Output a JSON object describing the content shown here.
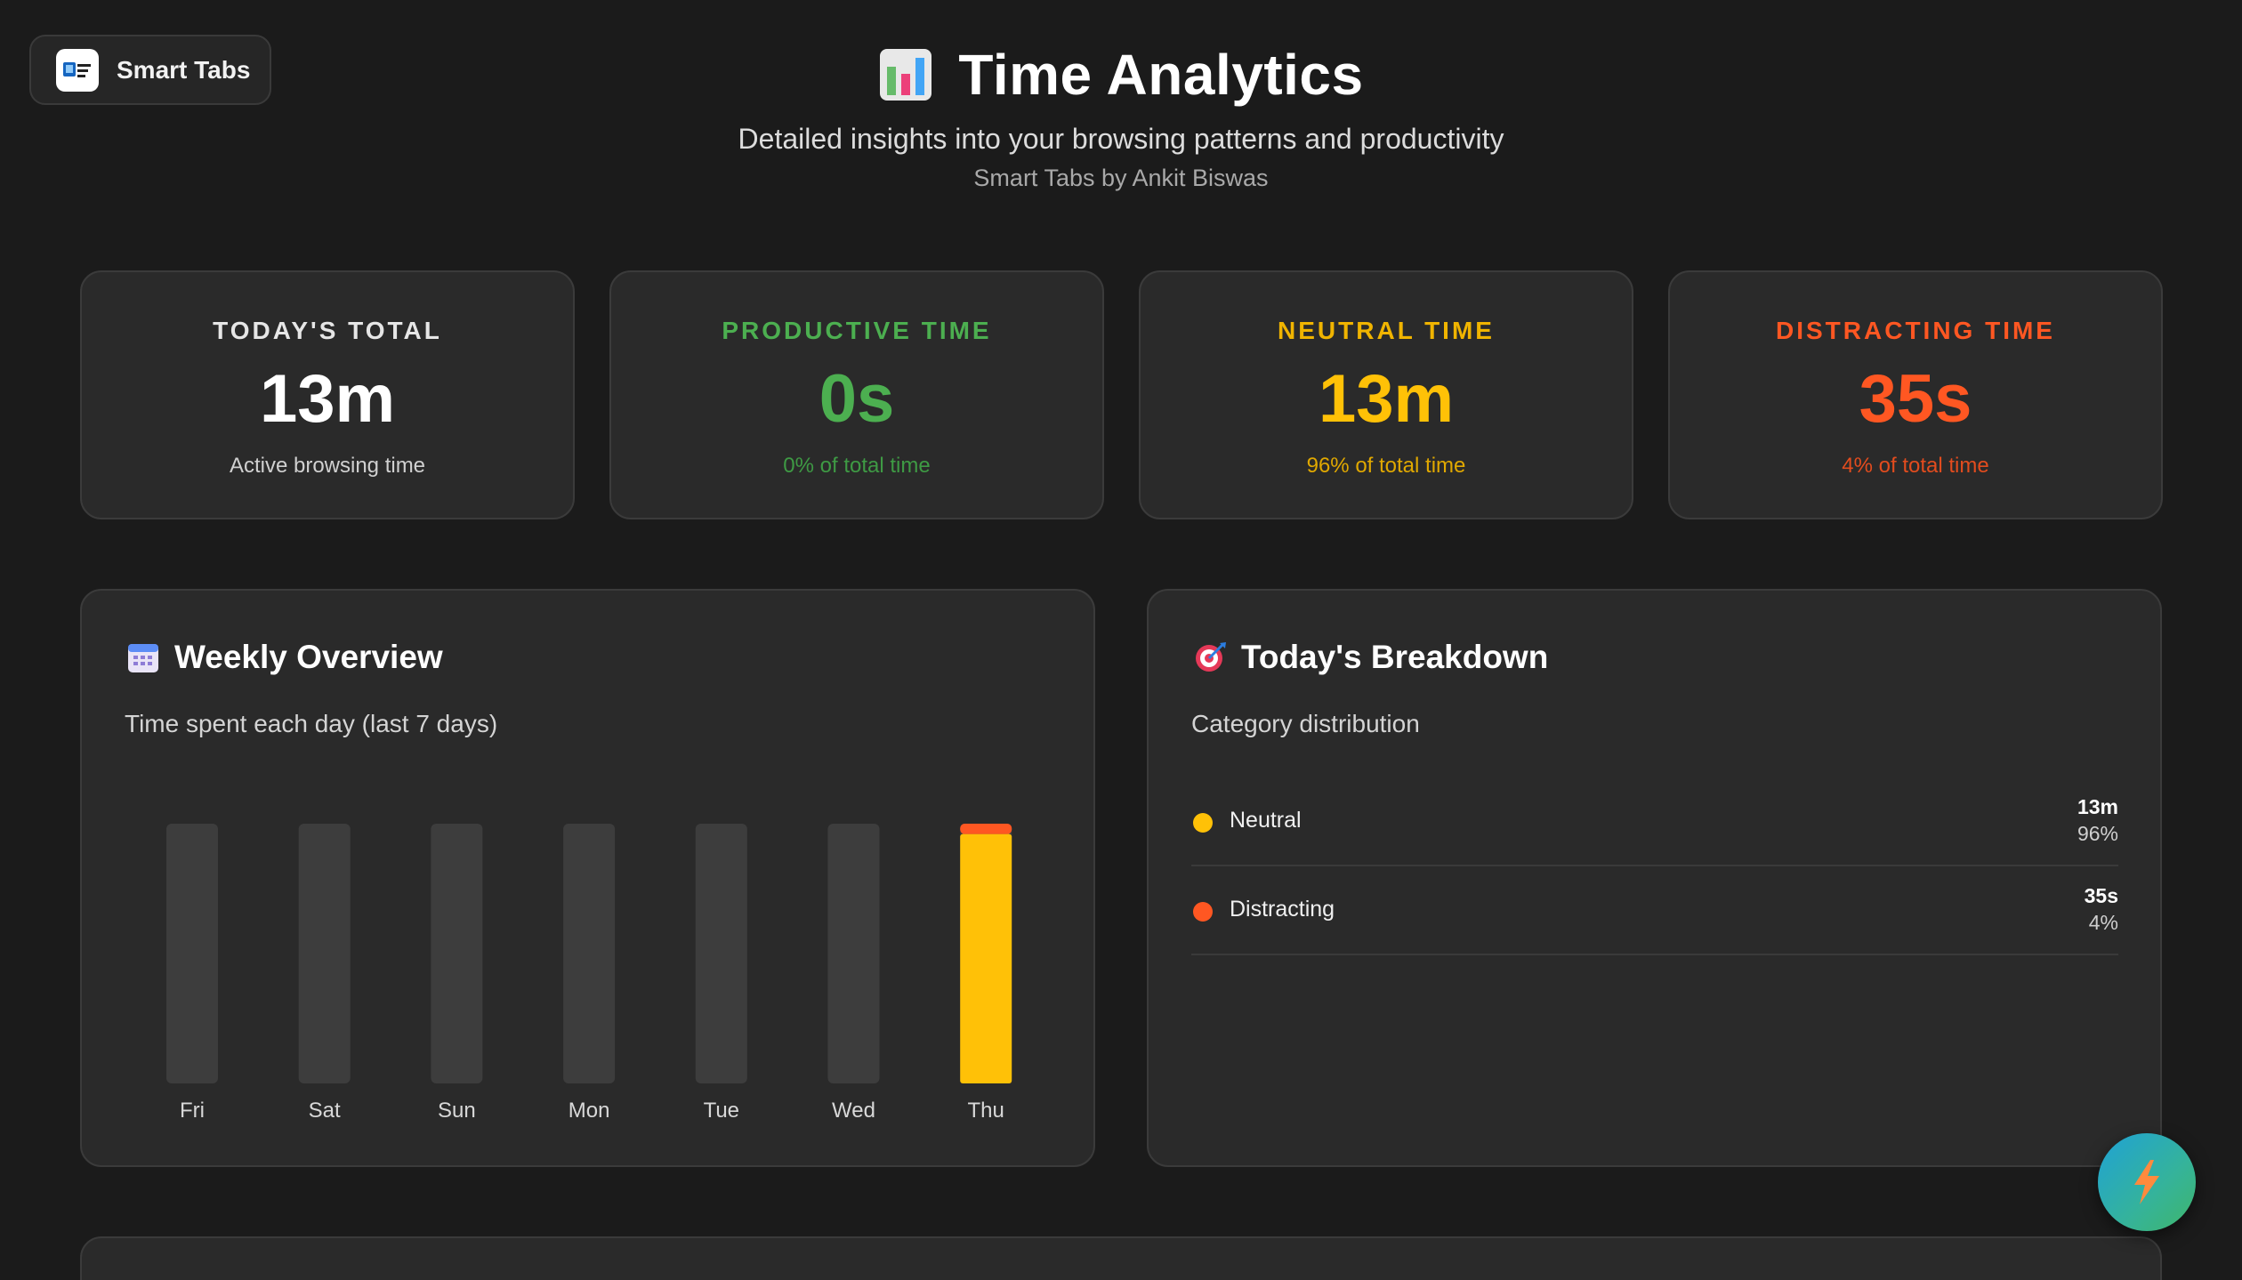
{
  "brand": {
    "name": "Smart Tabs"
  },
  "header": {
    "title": "Time Analytics",
    "subtitle": "Detailed insights into your browsing patterns and productivity",
    "byline": "Smart Tabs by Ankit Biswas"
  },
  "stats": {
    "total": {
      "label": "TODAY'S TOTAL",
      "value": "13m",
      "sub": "Active browsing time",
      "color": "#ffffff"
    },
    "productive": {
      "label": "PRODUCTIVE TIME",
      "value": "0s",
      "sub": "0% of total time",
      "color": "#4caf50"
    },
    "neutral": {
      "label": "NEUTRAL TIME",
      "value": "13m",
      "sub": "96% of total time",
      "color": "#ffc107"
    },
    "distracting": {
      "label": "DISTRACTING TIME",
      "value": "35s",
      "sub": "4% of total time",
      "color": "#ff5722"
    }
  },
  "weekly": {
    "title": "Weekly Overview",
    "description": "Time spent each day (last 7 days)"
  },
  "breakdown": {
    "title": "Today's Breakdown",
    "description": "Category distribution",
    "rows": [
      {
        "name": "Neutral",
        "time": "13m",
        "percent": "96%",
        "color": "#ffc107"
      },
      {
        "name": "Distracting",
        "time": "35s",
        "percent": "4%",
        "color": "#ff5722"
      }
    ]
  },
  "chart_data": {
    "type": "bar",
    "stacked": true,
    "categories": [
      "Fri",
      "Sat",
      "Sun",
      "Mon",
      "Tue",
      "Wed",
      "Thu"
    ],
    "series": [
      {
        "name": "Neutral",
        "color": "#ffc107",
        "values": [
          0,
          0,
          0,
          0,
          0,
          0,
          96
        ]
      },
      {
        "name": "Distracting",
        "color": "#ff5722",
        "values": [
          0,
          0,
          0,
          0,
          0,
          0,
          4
        ]
      }
    ],
    "max_total": 100,
    "track_color": "#3d3d3d",
    "title": "",
    "xlabel": "",
    "ylabel": ""
  }
}
